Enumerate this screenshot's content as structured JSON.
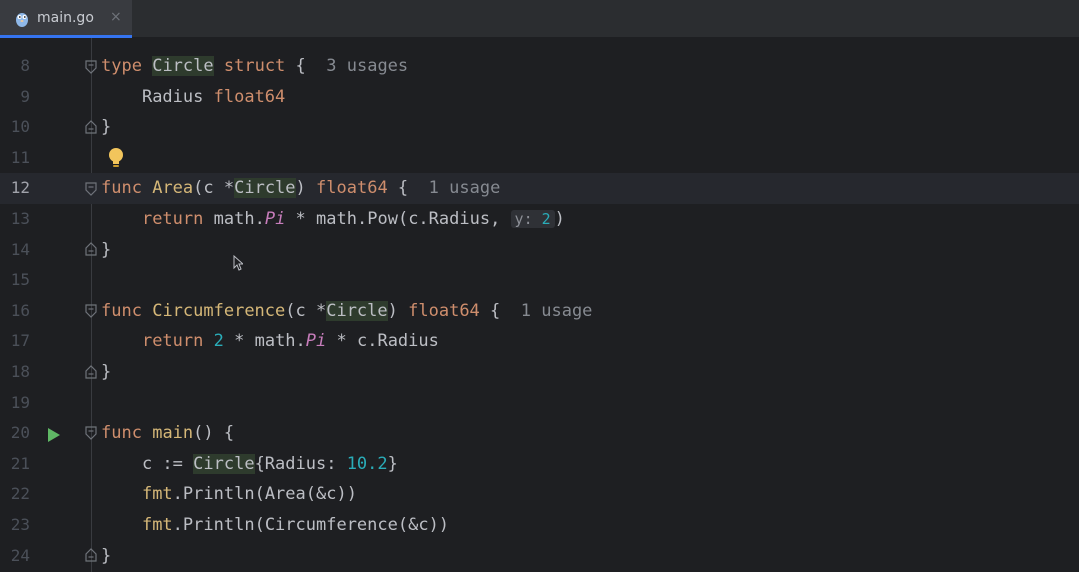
{
  "tab": {
    "file_name": "main.go",
    "close_glyph": "×",
    "icon": "go-gopher-icon"
  },
  "editor": {
    "lines": [
      {
        "no": "8"
      },
      {
        "no": "9"
      },
      {
        "no": "10"
      },
      {
        "no": "11"
      },
      {
        "no": "12"
      },
      {
        "no": "13"
      },
      {
        "no": "14"
      },
      {
        "no": "15"
      },
      {
        "no": "16"
      },
      {
        "no": "17"
      },
      {
        "no": "18"
      },
      {
        "no": "19"
      },
      {
        "no": "20"
      },
      {
        "no": "21"
      },
      {
        "no": "22"
      },
      {
        "no": "23"
      },
      {
        "no": "24"
      }
    ],
    "current_line": "12",
    "code": {
      "l8": {
        "kw_type": "type",
        "name": "Circle",
        "kw_struct": "struct",
        "brace": " {",
        "usages": "3 usages"
      },
      "l9": {
        "field": "Radius",
        "type": "float64"
      },
      "l10": {
        "brace": "}"
      },
      "l12": {
        "kw": "func",
        "name": "Area",
        "paren_open": "(c *",
        "type": "Circle",
        "paren_close": ")",
        "ret": "float64",
        "brace": " {",
        "usages": "1 usage"
      },
      "l13": {
        "kw": "return",
        "pkg1": "math",
        "dot1": ".",
        "const": "Pi",
        "op": " * ",
        "pkg2": "math",
        "dot2": ".",
        "call": "Pow",
        "args": "(c.Radius, ",
        "hint": "y:",
        "num": " 2",
        "close": ")"
      },
      "l14": {
        "brace": "}"
      },
      "l16": {
        "kw": "func",
        "name": "Circumference",
        "paren_open": "(c *",
        "type": "Circle",
        "paren_close": ")",
        "ret": "float64",
        "brace": " {",
        "usages": "1 usage"
      },
      "l17": {
        "kw": "return",
        "num": "2",
        "op1": " * ",
        "pkg": "math",
        "dot": ".",
        "const": "Pi",
        "rest": " * c.Radius"
      },
      "l18": {
        "brace": "}"
      },
      "l20": {
        "kw": "func",
        "name": "main",
        "rest": "() {"
      },
      "l21": {
        "var": "c := ",
        "type": "Circle",
        "open": "{Radius: ",
        "num": "10.2",
        "close": "}"
      },
      "l22": {
        "pkg": "fmt",
        "dot": ".",
        "call": "Println",
        "args": "(Area(&c))"
      },
      "l23": {
        "pkg": "fmt",
        "dot": ".",
        "call": "Println",
        "args": "(Circumference(&c))"
      },
      "l24": {
        "brace": "}"
      }
    }
  },
  "colors": {
    "background": "#1e1f22",
    "keyword": "#cf8e6d",
    "number": "#2aacb8",
    "constant": "#c77dbb",
    "run_icon": "#5fb865",
    "bulb": "#f2c55c"
  },
  "icons": [
    "run-icon",
    "lightbulb-icon",
    "fold-icon",
    "mouse-cursor-icon"
  ]
}
